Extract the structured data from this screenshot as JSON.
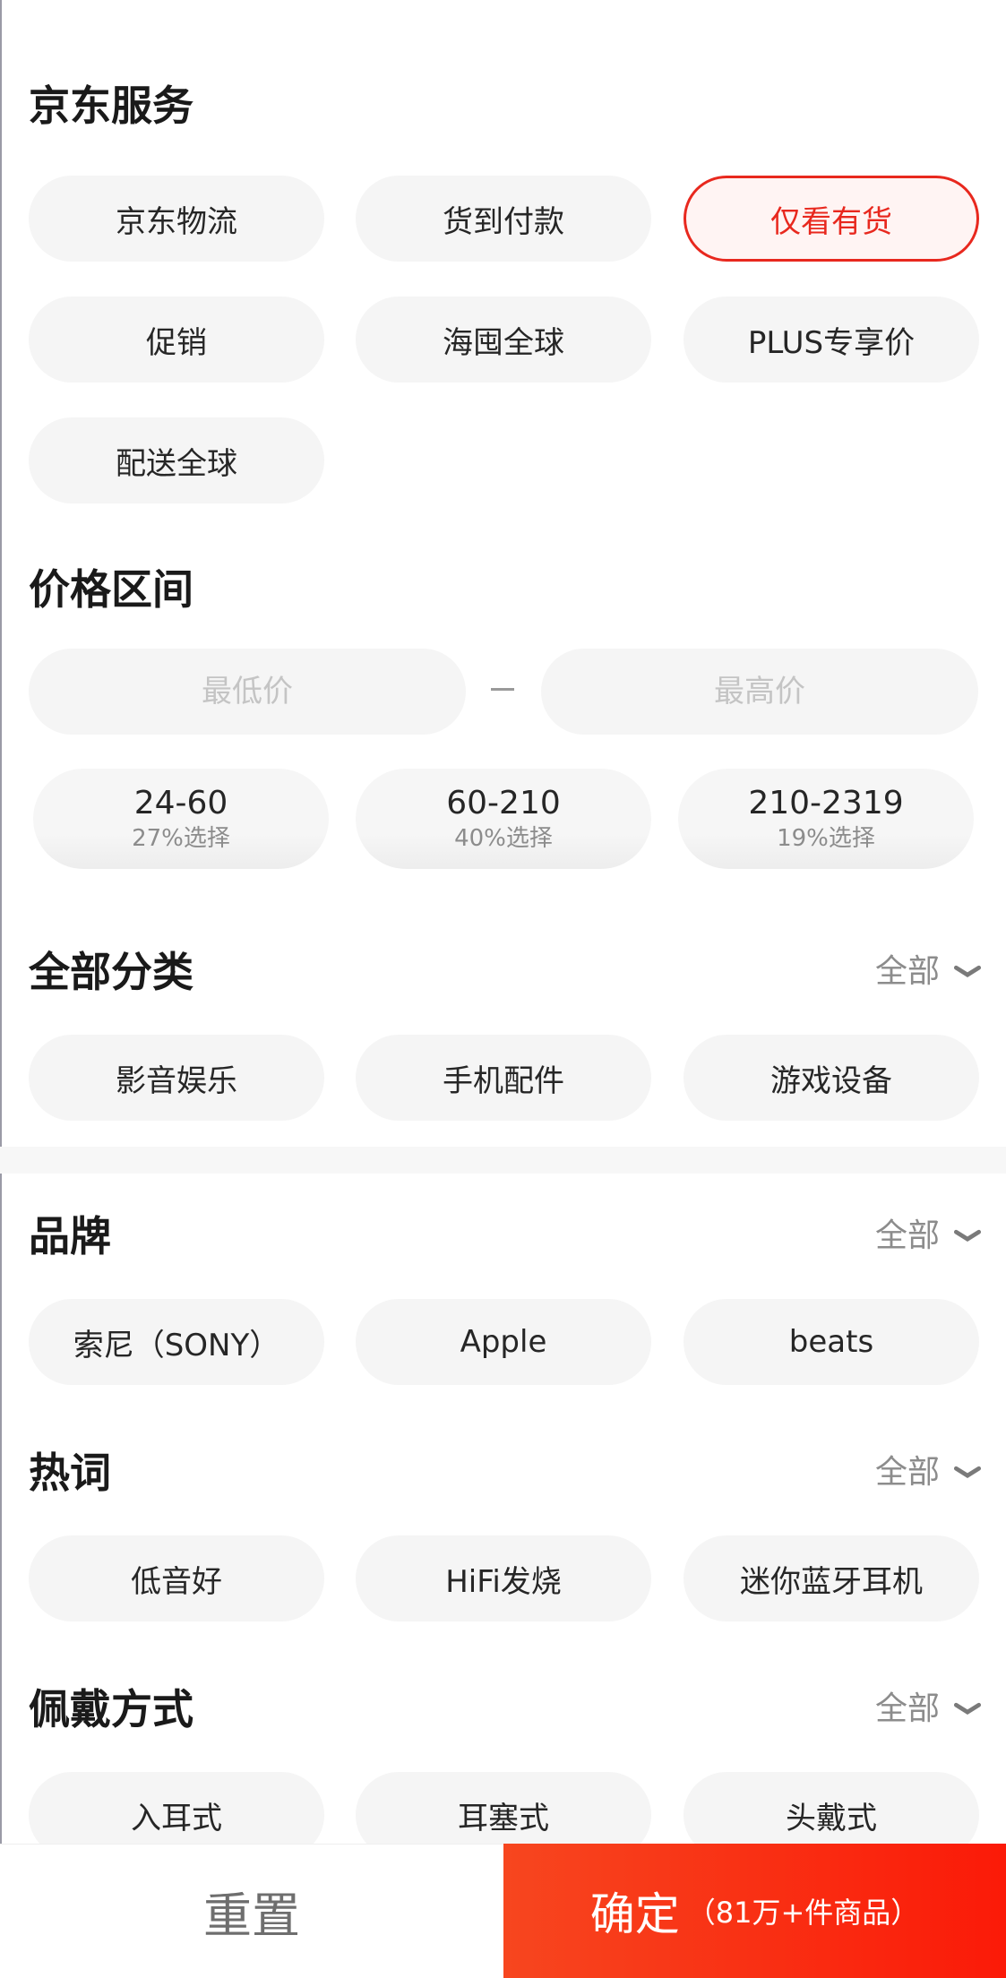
{
  "services": {
    "title": "京东服务",
    "chips": [
      "京东物流",
      "货到付款",
      "仅看有货",
      "促销",
      "海囤全球",
      "PLUS专享价",
      "配送全球"
    ]
  },
  "price": {
    "title": "价格区间",
    "min_placeholder": "最低价",
    "max_placeholder": "最高价",
    "ranges": [
      {
        "range": "24-60",
        "pct": "27%选择"
      },
      {
        "range": "60-210",
        "pct": "40%选择"
      },
      {
        "range": "210-2319",
        "pct": "19%选择"
      }
    ]
  },
  "category": {
    "title": "全部分类",
    "more": "全部",
    "chips": [
      "影音娱乐",
      "手机配件",
      "游戏设备"
    ]
  },
  "brand": {
    "title": "品牌",
    "more": "全部",
    "chips": [
      "索尼（SONY）",
      "Apple",
      "beats"
    ]
  },
  "hotwords": {
    "title": "热词",
    "more": "全部",
    "chips": [
      "低音好",
      "HiFi发烧",
      "迷你蓝牙耳机"
    ]
  },
  "wear": {
    "title": "佩戴方式",
    "more": "全部",
    "chips": [
      "入耳式",
      "耳塞式",
      "头戴式"
    ]
  },
  "footer": {
    "reset": "重置",
    "confirm": "确定",
    "confirm_count": "（81万+件商品）"
  },
  "colors": {
    "accent": "#e8281e",
    "confirm_gradient": [
      "#f7461f",
      "#fb1a08"
    ]
  }
}
